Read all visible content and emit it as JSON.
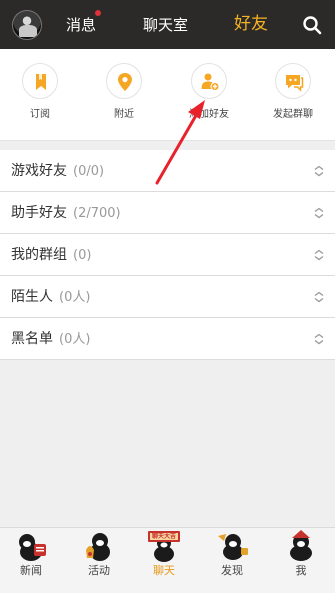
{
  "header": {
    "tabs": [
      {
        "label": "消息"
      },
      {
        "label": "聊天室"
      },
      {
        "label": "好友"
      }
    ],
    "active_color": "#f5b324"
  },
  "shortcuts": [
    {
      "label": "订阅",
      "icon": "bookmark-icon"
    },
    {
      "label": "附近",
      "icon": "location-icon"
    },
    {
      "label": "添加好友",
      "icon": "add-friend-icon"
    },
    {
      "label": "发起群聊",
      "icon": "group-chat-icon"
    }
  ],
  "groups": [
    {
      "name": "游戏好友",
      "count": "(0/0)"
    },
    {
      "name": "助手好友",
      "count": "(2/700)"
    },
    {
      "name": "我的群组",
      "count": "(0)"
    },
    {
      "name": "陌生人",
      "count": "(0人)"
    },
    {
      "name": "黑名单",
      "count": "(0人)"
    }
  ],
  "bottom_nav": [
    {
      "label": "新闻",
      "icon": "news-mascot-icon"
    },
    {
      "label": "活动",
      "icon": "activity-mascot-icon"
    },
    {
      "label": "聊天",
      "icon": "chat-mascot-icon",
      "sign": "聊天大吉"
    },
    {
      "label": "发现",
      "icon": "discover-mascot-icon"
    },
    {
      "label": "我",
      "icon": "me-mascot-icon"
    }
  ],
  "colors": {
    "accent": "#f5b324",
    "topbar": "#2b2a29",
    "arrow": "#e8222a"
  }
}
